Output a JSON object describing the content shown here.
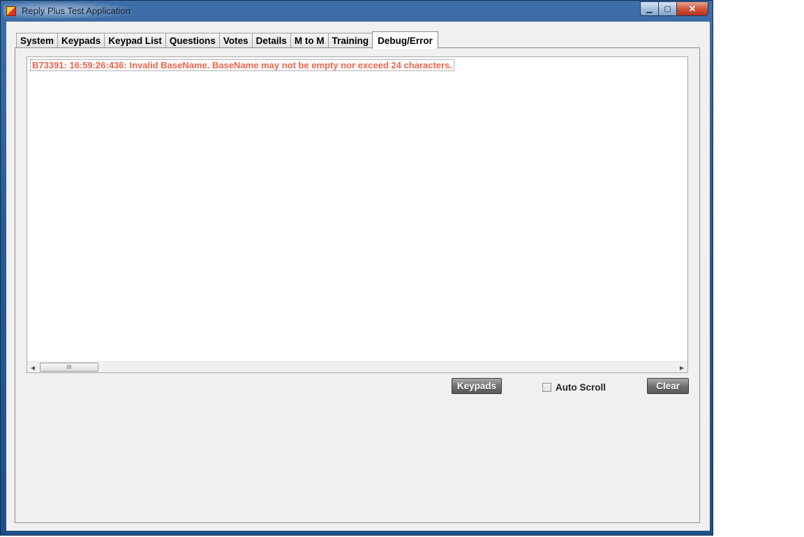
{
  "window": {
    "title": "Reply Plus Test Application",
    "controls": {
      "minimize_glyph": "▁",
      "maximize_glyph": "▢",
      "close_glyph": "✕"
    }
  },
  "tabs": [
    {
      "label": "System",
      "active": false
    },
    {
      "label": "Keypads",
      "active": false
    },
    {
      "label": "Keypad List",
      "active": false
    },
    {
      "label": "Questions",
      "active": false
    },
    {
      "label": "Votes",
      "active": false
    },
    {
      "label": "Details",
      "active": false
    },
    {
      "label": "M to M",
      "active": false
    },
    {
      "label": "Training",
      "active": false
    },
    {
      "label": "Debug/Error",
      "active": true
    }
  ],
  "log": {
    "lines": [
      "B73391: 16:59:26:436: Invalid BaseName.  BaseName may not be empty nor exceed 24 characters."
    ],
    "error_color": "#f0634a"
  },
  "scrollbar": {
    "left_arrow": "◀",
    "right_arrow": "▶",
    "thumb_grip": "III"
  },
  "actions": {
    "keypads_label": "Keypads",
    "auto_scroll_label": "Auto Scroll",
    "auto_scroll_checked": false,
    "clear_label": "Clear"
  }
}
